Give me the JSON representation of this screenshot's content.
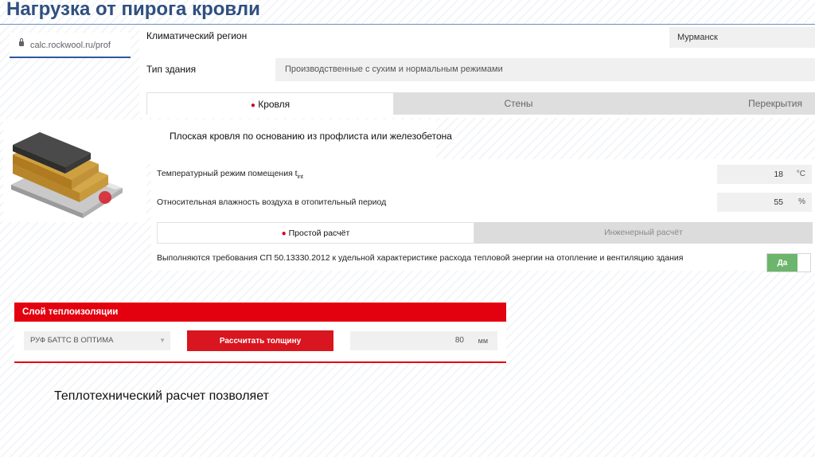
{
  "slide_title": "Нагрузка от пирога кровли",
  "browser": {
    "url": "calc.rockwool.ru/prof"
  },
  "form": {
    "region_label": "Климатический регион",
    "region_value": "Мурманск",
    "building_label": "Тип здания",
    "building_value": "Производственные с сухим и нормальным режимами",
    "tabs": [
      {
        "label": "Кровля",
        "active": true
      },
      {
        "label": "Стены",
        "active": false
      },
      {
        "label": "Перекрытия",
        "active": false
      }
    ]
  },
  "roof": {
    "type_title": "Плоская кровля по основанию из профлиста или железобетона",
    "temp_label": "Температурный режим помещения t",
    "temp_sub": "int",
    "temp_value": "18",
    "temp_unit": "°C",
    "humidity_label": "Относительная влажность воздуха в отопительный период",
    "humidity_value": "55",
    "humidity_unit": "%",
    "calc_tabs": [
      {
        "label": "Простой расчёт",
        "active": true
      },
      {
        "label": "Инженерный расчёт",
        "active": false
      }
    ],
    "requirement_text": "Выполняются требования СП 50.13330.2012 к удельной характеристике расхода тепловой энергии на отопление и вентиляцию здания",
    "toggle_label": "Да"
  },
  "insulation": {
    "header": "Слой теплоизоляции",
    "product": "РУФ БАТТС В ОПТИМА",
    "button_label": "Рассчитать толщину",
    "thickness_value": "80",
    "thickness_unit": "мм"
  },
  "caption": "Теплотехнический расчет позволяет",
  "colors": {
    "accent_red": "#e3000f",
    "title_blue": "#2f4f7f",
    "toggle_green": "#6cb56c"
  }
}
